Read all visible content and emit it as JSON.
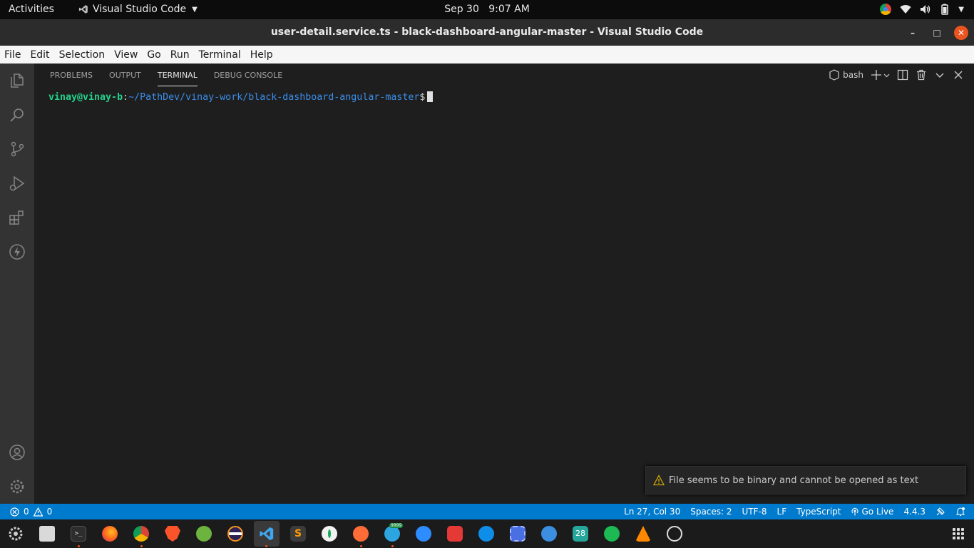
{
  "topbar": {
    "activities": "Activities",
    "app_name": "Visual Studio Code",
    "date": "Sep 30",
    "time": "9:07 AM"
  },
  "window": {
    "title": "user-detail.service.ts - black-dashboard-angular-master - Visual Studio Code"
  },
  "menubar": {
    "items": [
      "File",
      "Edit",
      "Selection",
      "View",
      "Go",
      "Run",
      "Terminal",
      "Help"
    ]
  },
  "activitybar": {
    "icons": [
      "explorer-icon",
      "search-icon",
      "source-control-icon",
      "run-debug-icon",
      "extensions-icon",
      "lightning-icon",
      "account-icon",
      "settings-gear-icon"
    ]
  },
  "panel": {
    "tabs": [
      "PROBLEMS",
      "OUTPUT",
      "TERMINAL",
      "DEBUG CONSOLE"
    ],
    "active_tab": "TERMINAL",
    "shell": "bash"
  },
  "terminal": {
    "user_host": "vinay@vinay-b",
    "separator": ":",
    "path": "~/PathDev/vinay-work/black-dashboard-angular-master",
    "prompt": "$"
  },
  "notification": {
    "message": "File seems to be binary and cannot be opened as text"
  },
  "statusbar": {
    "errors": "0",
    "warnings": "0",
    "position": "Ln 27, Col 30",
    "spaces": "Spaces: 2",
    "encoding": "UTF-8",
    "eol": "LF",
    "language": "TypeScript",
    "golive": "Go Live",
    "version": "4.4.3"
  },
  "dock": {
    "badge": "9999",
    "calendar_day": "28"
  },
  "colors": {
    "accent": "#007acc",
    "terminal_user": "#23d18b",
    "terminal_path": "#3b8eea",
    "close_button": "#e95420"
  }
}
